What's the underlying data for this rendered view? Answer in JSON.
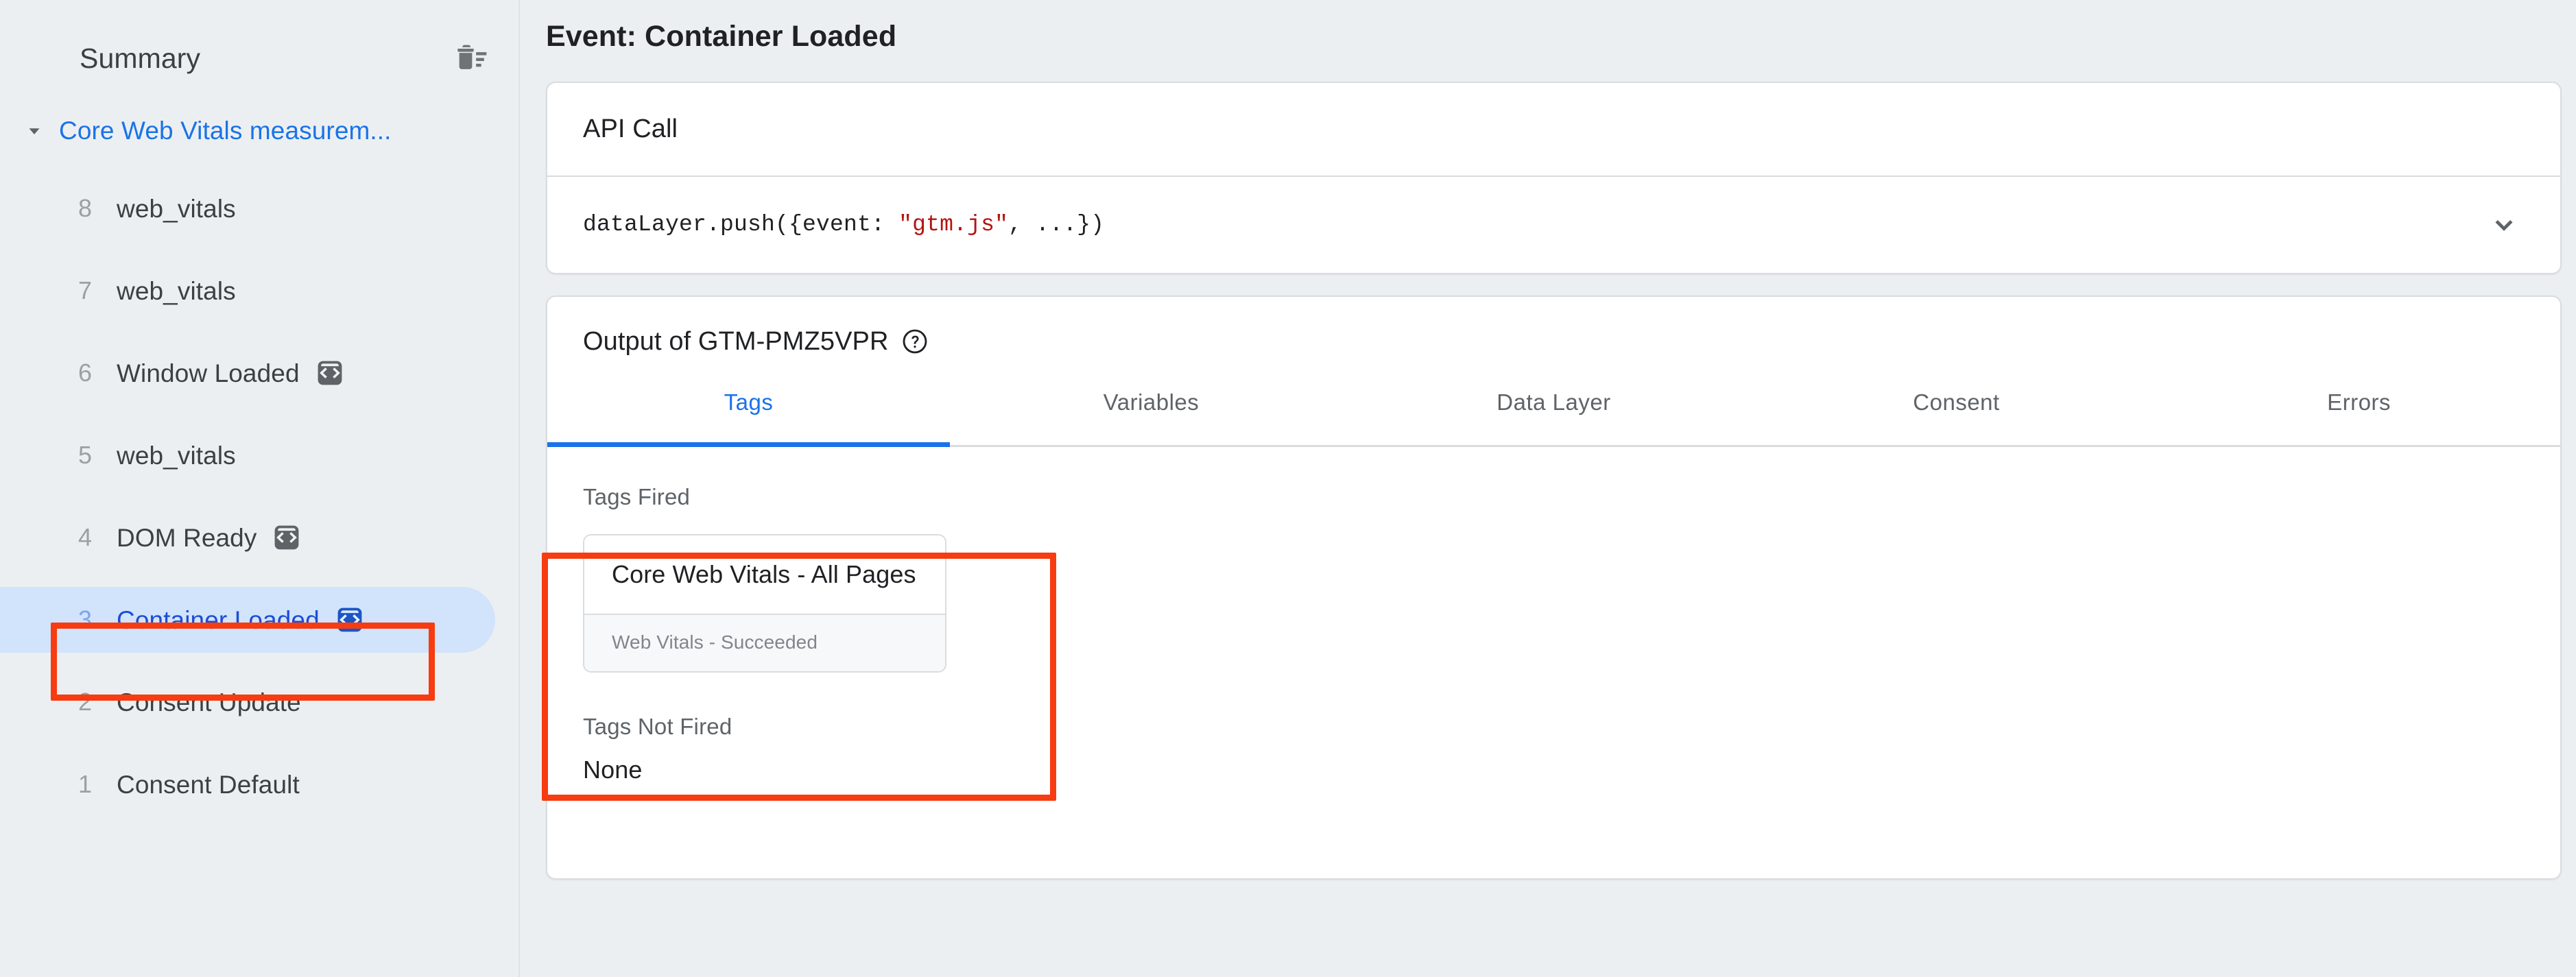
{
  "sidebar": {
    "title": "Summary",
    "clear_icon": "trash-list-icon",
    "group": {
      "label": "Core Web Vitals measurem...",
      "caret_icon": "caret-down-icon",
      "expanded": true
    },
    "events": [
      {
        "num": "8",
        "name": "web_vitals",
        "has_code_badge": false,
        "selected": false
      },
      {
        "num": "7",
        "name": "web_vitals",
        "has_code_badge": false,
        "selected": false
      },
      {
        "num": "6",
        "name": "Window Loaded",
        "has_code_badge": true,
        "selected": false
      },
      {
        "num": "5",
        "name": "web_vitals",
        "has_code_badge": false,
        "selected": false
      },
      {
        "num": "4",
        "name": "DOM Ready",
        "has_code_badge": true,
        "selected": false
      },
      {
        "num": "3",
        "name": "Container Loaded",
        "has_code_badge": true,
        "selected": true
      },
      {
        "num": "2",
        "name": "Consent Update",
        "has_code_badge": false,
        "selected": false
      },
      {
        "num": "1",
        "name": "Consent Default",
        "has_code_badge": false,
        "selected": false
      }
    ]
  },
  "main": {
    "page_title": "Event: Container Loaded",
    "api_call": {
      "heading": "API Call",
      "code_prefix": "dataLayer.push({event: ",
      "code_string": "\"gtm.js\"",
      "code_suffix": ", ...})",
      "expand_icon": "chevron-down-icon"
    },
    "output": {
      "title": "Output of GTM-PMZ5VPR",
      "help_icon": "help-circle-icon",
      "tabs": [
        {
          "label": "Tags",
          "active": true
        },
        {
          "label": "Variables",
          "active": false
        },
        {
          "label": "Data Layer",
          "active": false
        },
        {
          "label": "Consent",
          "active": false
        },
        {
          "label": "Errors",
          "active": false
        }
      ],
      "tags_fired": {
        "label": "Tags Fired",
        "items": [
          {
            "name": "Core Web Vitals - All Pages",
            "status": "Web Vitals - Succeeded"
          }
        ]
      },
      "tags_not_fired": {
        "label": "Tags Not Fired",
        "value": "None"
      }
    }
  },
  "colors": {
    "background": "#eceff1",
    "accent_blue": "#1a73e8",
    "selected_pill": "#d2e3fc",
    "annotation_red": "#f63c10",
    "card_border": "#dadce0",
    "text_primary": "#202124",
    "text_secondary": "#5f6368",
    "code_string": "#b31412"
  }
}
